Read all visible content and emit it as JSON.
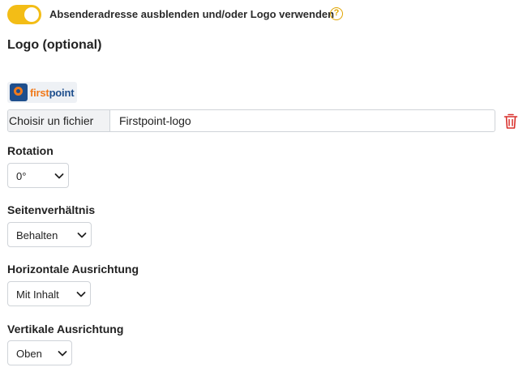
{
  "toggle": {
    "label": "Absenderadresse ausblenden und/oder Logo verwenden",
    "state": "on"
  },
  "help_icon": {
    "glyph": "?"
  },
  "logo_section": {
    "title": "Logo (optional)",
    "logo_text_first": "first",
    "logo_text_point": "point",
    "file_button_label": "Choisir un fichier",
    "file_name": "Firstpoint-logo"
  },
  "fields": {
    "rotation": {
      "label": "Rotation",
      "value": "0°"
    },
    "aspect": {
      "label": "Seitenverhältnis",
      "value": "Behalten"
    },
    "horizontal": {
      "label": "Horizontale Ausrichtung",
      "value": "Mit Inhalt"
    },
    "vertical": {
      "label": "Vertikale Ausrichtung",
      "value": "Oben"
    }
  },
  "colors": {
    "accent": "#f3bd16",
    "danger": "#d9302c",
    "logo_orange": "#f07a1c",
    "logo_blue": "#1f4f8d"
  }
}
